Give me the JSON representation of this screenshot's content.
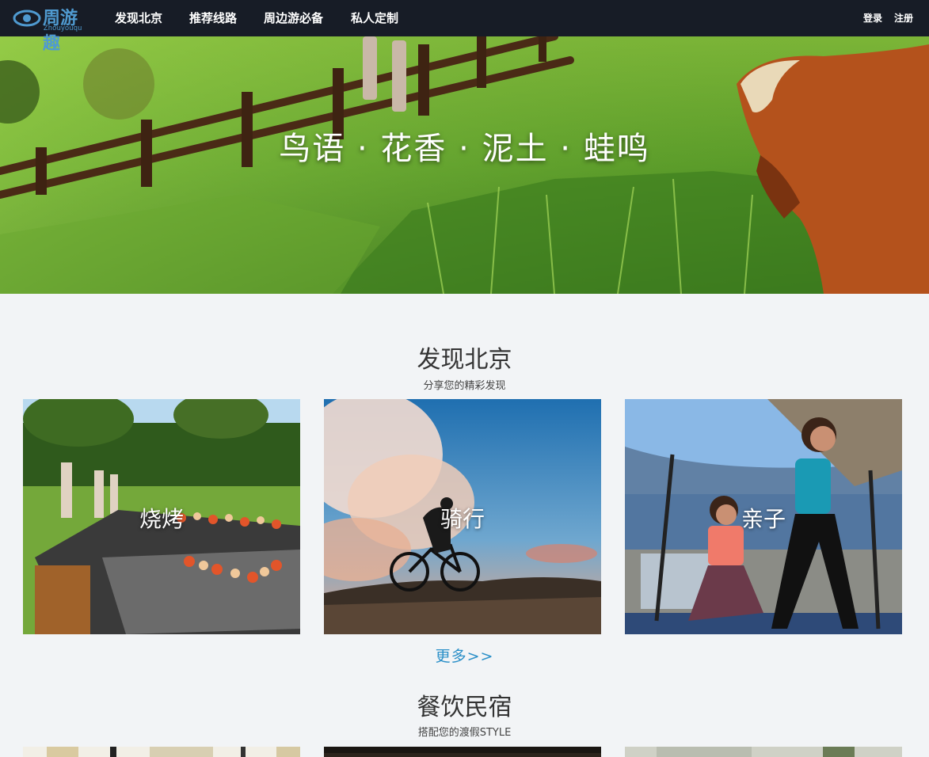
{
  "nav": {
    "logo_cn": "周游趣",
    "logo_en": "Zhouyouqu",
    "links": [
      "发现北京",
      "推荐线路",
      "周边游必备",
      "私人定制"
    ],
    "login": "登录",
    "register": "注册"
  },
  "hero": {
    "caption": "鸟语 · 花香 · 泥土 · 蛙鸣"
  },
  "discover": {
    "title": "发现北京",
    "subtitle": "分享您的精彩发现",
    "cards": [
      {
        "label": "烧烤"
      },
      {
        "label": "骑行"
      },
      {
        "label": "亲子"
      }
    ],
    "more": "更多>>"
  },
  "dining": {
    "title": "餐饮民宿",
    "subtitle": "搭配您的渡假STYLE"
  }
}
